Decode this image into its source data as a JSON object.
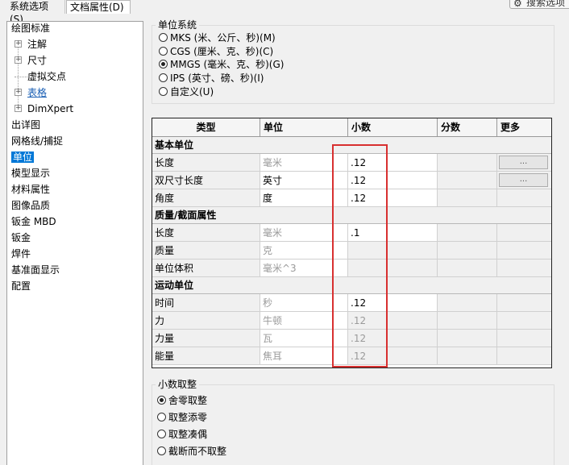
{
  "tabs": [
    "系统选项(S)",
    "文档属性(D)"
  ],
  "search_label": "搜索选项",
  "tree": [
    {
      "label": "绘图标准",
      "level": 0
    },
    {
      "label": "注解",
      "level": 1,
      "expandable": true
    },
    {
      "label": "尺寸",
      "level": 1,
      "expandable": true
    },
    {
      "label": "虚拟交点",
      "level": 1,
      "expandable": false
    },
    {
      "label": "表格",
      "level": 1,
      "expandable": true,
      "link": true
    },
    {
      "label": "DimXpert",
      "level": 1,
      "expandable": true
    },
    {
      "label": "出详图",
      "level": 0
    },
    {
      "label": "网格线/捕捉",
      "level": 0
    },
    {
      "label": "单位",
      "level": 0,
      "selected": true
    },
    {
      "label": "模型显示",
      "level": 0
    },
    {
      "label": "材料属性",
      "level": 0
    },
    {
      "label": "图像品质",
      "level": 0
    },
    {
      "label": "钣金 MBD",
      "level": 0
    },
    {
      "label": "钣金",
      "level": 0
    },
    {
      "label": "焊件",
      "level": 0
    },
    {
      "label": "基准面显示",
      "level": 0
    },
    {
      "label": "配置",
      "level": 0
    }
  ],
  "unit_system": {
    "title": "单位系统",
    "options": [
      {
        "label": "MKS (米、公斤、秒)(M)",
        "checked": false
      },
      {
        "label": "CGS (厘米、克、秒)(C)",
        "checked": false
      },
      {
        "label": "MMGS (毫米、克、秒)(G)",
        "checked": true
      },
      {
        "label": "IPS (英寸、磅、秒)(I)",
        "checked": false
      },
      {
        "label": "自定义(U)",
        "checked": false
      }
    ]
  },
  "table": {
    "headers": [
      "类型",
      "单位",
      "小数",
      "分数",
      "更多"
    ],
    "more_button": "...",
    "sections": [
      {
        "title": "基本单位",
        "rows": [
          {
            "type": "长度",
            "unit": "毫米",
            "unit_gray": true,
            "decimal": ".12",
            "decimal_gray": false,
            "more": true
          },
          {
            "type": "双尺寸长度",
            "unit": "英寸",
            "unit_gray": false,
            "decimal": ".12",
            "decimal_gray": false,
            "more": true
          },
          {
            "type": "角度",
            "unit": "度",
            "unit_gray": false,
            "decimal": ".12",
            "decimal_gray": false,
            "more": false
          }
        ]
      },
      {
        "title": "质量/截面属性",
        "rows": [
          {
            "type": "长度",
            "unit": "毫米",
            "unit_gray": true,
            "decimal": ".1",
            "decimal_gray": false,
            "more": false
          },
          {
            "type": "质量",
            "unit": "克",
            "unit_gray": true,
            "decimal": "",
            "decimal_gray": true,
            "more": false
          },
          {
            "type": "单位体积",
            "unit": "毫米^3",
            "unit_gray": true,
            "decimal": "",
            "decimal_gray": true,
            "more": false
          }
        ]
      },
      {
        "title": "运动单位",
        "rows": [
          {
            "type": "时间",
            "unit": "秒",
            "unit_gray": true,
            "decimal": ".12",
            "decimal_gray": false,
            "more": false
          },
          {
            "type": "力",
            "unit": "牛顿",
            "unit_gray": true,
            "decimal": ".12",
            "decimal_gray": true,
            "more": false
          },
          {
            "type": "力量",
            "unit": "瓦",
            "unit_gray": true,
            "decimal": ".12",
            "decimal_gray": true,
            "more": false
          },
          {
            "type": "能量",
            "unit": "焦耳",
            "unit_gray": true,
            "decimal": ".12",
            "decimal_gray": true,
            "more": false
          }
        ]
      }
    ]
  },
  "rounding": {
    "title": "小数取整",
    "options": [
      {
        "label": "舍零取整",
        "checked": true
      },
      {
        "label": "取整添零",
        "checked": false
      },
      {
        "label": "取整凑偶",
        "checked": false
      },
      {
        "label": "截断而不取整",
        "checked": false
      }
    ]
  },
  "colors": {
    "highlight_box": "#d83030",
    "selection": "#0078d7"
  }
}
